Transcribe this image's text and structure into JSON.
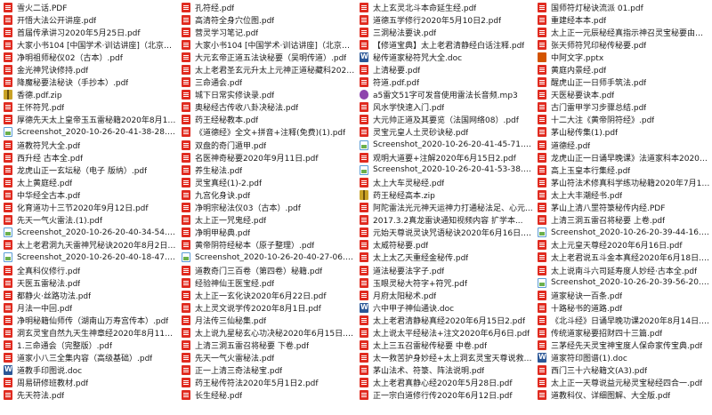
{
  "columns": [
    [
      {
        "name": "雪火二话.PDF",
        "type": "pdf"
      },
      {
        "name": "开悟大法公开讲座.pdf",
        "type": "pdf"
      },
      {
        "name": "首届传承讲习2020年5月25日.pdf",
        "type": "pdf"
      },
      {
        "name": "大家小书104 [中国学术·训诂讲座]（北京出版...",
        "type": "pdf"
      },
      {
        "name": "净明祖师秘仪02（古本）.pdf",
        "type": "pdf"
      },
      {
        "name": "金光神咒诀修持.pdf",
        "type": "pdf"
      },
      {
        "name": "降魔秘要法秘诀（手抄本）.pdf",
        "type": "pdf"
      },
      {
        "name": "香德.pdf.zip",
        "type": "zip"
      },
      {
        "name": "王怀符咒.pdf",
        "type": "pdf"
      },
      {
        "name": "厚德先天太上皇帝玉五雷秘籍2020年8月17日...",
        "type": "pdf"
      },
      {
        "name": "Screenshot_2020-10-26-20-41-38-28.png",
        "type": "png"
      },
      {
        "name": "道教符咒大全.pdf",
        "type": "pdf"
      },
      {
        "name": "西升经 古本全.pdf",
        "type": "pdf"
      },
      {
        "name": "龙虎山正一玄坛秘（电子 版纳）.pdf",
        "type": "pdf"
      },
      {
        "name": "太上黄庭经.pdf",
        "type": "pdf"
      },
      {
        "name": "中华经全古本.pdf",
        "type": "pdf"
      },
      {
        "name": "化育道功十三节2020年9月12日.pdf",
        "type": "pdf"
      },
      {
        "name": "先天一气火雷法.(1).pdf",
        "type": "pdf"
      },
      {
        "name": "Screenshot_2020-10-26-20-40-34-54.png",
        "type": "png"
      },
      {
        "name": "太上老君洞九天雷神咒秘诀2020年8月2日.p...",
        "type": "pdf"
      },
      {
        "name": "Screenshot_2020-10-26-20-40-18-47.png",
        "type": "png"
      },
      {
        "name": "全真科仪修行.pdf",
        "type": "pdf"
      },
      {
        "name": "天医五雷秘法.pdf",
        "type": "pdf"
      },
      {
        "name": "都静火·丝路功法.pdf",
        "type": "pdf"
      },
      {
        "name": "月法一中回.pdf",
        "type": "pdf"
      },
      {
        "name": "净明秘籍仙师传（湖南山万寿宫传本）.pdf",
        "type": "pdf"
      },
      {
        "name": "洞玄灵宝自然九天生神章经2020年8月11日.pdf",
        "type": "pdf"
      },
      {
        "name": "1.三命通会（完整版）.pdf",
        "type": "pdf"
      },
      {
        "name": "道家小八三全集内容（高级基础）.pdf",
        "type": "pdf"
      },
      {
        "name": "道教手印图说.doc",
        "type": "doc"
      },
      {
        "name": "周易研修班教材.pdf",
        "type": "pdf"
      },
      {
        "name": "先天符法.pdf",
        "type": "pdf"
      }
    ],
    [
      {
        "name": "孔符经.pdf",
        "type": "pdf"
      },
      {
        "name": "高清符全身穴位图.pdf",
        "type": "pdf"
      },
      {
        "name": "营灵学习笔记.pdf",
        "type": "pdf"
      },
      {
        "name": "大家小书104 [中国学术·训诂讲座]（北京出版...",
        "type": "pdf"
      },
      {
        "name": "大元玄帝正道五法诀秘要（吴明传道）.pdf",
        "type": "pdf"
      },
      {
        "name": "太上老君圣玄元升太上元神正道秘藏科2020年5...",
        "type": "pdf"
      },
      {
        "name": "三命通会.pdf",
        "type": "pdf"
      },
      {
        "name": "城下日常实修诀录.pdf",
        "type": "pdf"
      },
      {
        "name": "奥秘经古传收八卦决秘法.pdf",
        "type": "pdf"
      },
      {
        "name": "药王经秘教本.pdf",
        "type": "pdf"
      },
      {
        "name": "《道德经》全文+拼音+注释(免费)(1).pdf",
        "type": "pdf"
      },
      {
        "name": "双盘的奇门遁甲.pdf",
        "type": "pdf"
      },
      {
        "name": "名医神奇秘要2020年9月11日.pdf",
        "type": "pdf"
      },
      {
        "name": "养生秘法.pdf",
        "type": "pdf"
      },
      {
        "name": "灵宝真经(1)-2.pdf",
        "type": "pdf"
      },
      {
        "name": "九宫化身诀.pdf",
        "type": "pdf"
      },
      {
        "name": "净明宗秘法仪03（古本）.pdf",
        "type": "pdf"
      },
      {
        "name": "太上正一咒鬼经.pdf",
        "type": "pdf"
      },
      {
        "name": "净明甲秘典.pdf",
        "type": "pdf"
      },
      {
        "name": "黄帝阴符经秘本（原子整理）.pdf",
        "type": "pdf"
      },
      {
        "name": "Screenshot_2020-10-26-20-40-27-06.png",
        "type": "png"
      },
      {
        "name": "道教奇门三百卷（第四卷）秘籍.pdf",
        "type": "pdf"
      },
      {
        "name": "经验神仙王医宝经.pdf",
        "type": "pdf"
      },
      {
        "name": "太上正一玄化诀2020年6月22日.pdf",
        "type": "pdf"
      },
      {
        "name": "太上灵文说学传2020年8月1日.pdf",
        "type": "pdf"
      },
      {
        "name": "月法传三仙秘集.pdf",
        "type": "pdf"
      },
      {
        "name": "太上说九星秘玄心功决秘2020年6月15日.pdf",
        "type": "pdf"
      },
      {
        "name": "上清三洞五雷召将秘要 下卷.pdf",
        "type": "pdf"
      },
      {
        "name": "先天一气火雷秘法.pdf",
        "type": "pdf"
      },
      {
        "name": "正一上清三奇法秘宝.pdf",
        "type": "pdf"
      },
      {
        "name": "药王秘传符法2020年5月1日2.pdf",
        "type": "pdf"
      },
      {
        "name": "长生经秘.pdf",
        "type": "pdf"
      }
    ],
    [
      {
        "name": "太上玄灵北斗本命延生经.pdf",
        "type": "pdf"
      },
      {
        "name": "道德五学修行2020年5月10日2.pdf",
        "type": "pdf"
      },
      {
        "name": "三洞秘法要诀.pdf",
        "type": "pdf"
      },
      {
        "name": "【修道宝典】太上老君清静经白话注释.pdf",
        "type": "pdf"
      },
      {
        "name": "秘传道家秘符咒大全.doc",
        "type": "doc"
      },
      {
        "name": "上清秘要.pdf",
        "type": "pdf"
      },
      {
        "name": "符道.pdf.pdf",
        "type": "pdf"
      },
      {
        "name": "a5雷文51字可发音使用雷法长音频.mp3",
        "type": "mp3"
      },
      {
        "name": "风水学快速入门.pdf",
        "type": "pdf"
      },
      {
        "name": "大元帅正道及其要览（法国网络08）.pdf",
        "type": "pdf"
      },
      {
        "name": "灵宝元皇人土灵砂诀秘.pdf",
        "type": "pdf"
      },
      {
        "name": "Screenshot_2020-10-26-20-41-45-71.png",
        "type": "png"
      },
      {
        "name": "观明大道要+注解2020年6月15日2.pdf",
        "type": "pdf"
      },
      {
        "name": "Screenshot_2020-10-26-20-41-53-38.png",
        "type": "png"
      },
      {
        "name": "太上大车灵秘经.pdf",
        "type": "pdf"
      },
      {
        "name": "药王秘经高本.zip",
        "type": "zip"
      },
      {
        "name": "阿陀雷法光元神天运神力打通秘法足、心元...",
        "type": "pdf"
      },
      {
        "name": "2017.3.2真龙雷诀通知视频内容 扩学本...",
        "type": "pdf"
      },
      {
        "name": "元始天尊说灵诀咒语秘诀2020年6月16日.pdf",
        "type": "pdf"
      },
      {
        "name": "太威符秘要.pdf",
        "type": "pdf"
      },
      {
        "name": "太上太乙天重经金秘传.pdf",
        "type": "pdf"
      },
      {
        "name": "道法秘要法字子.pdf",
        "type": "pdf"
      },
      {
        "name": "玉眼灵秘大符字+符咒.pdf",
        "type": "pdf"
      },
      {
        "name": "月府太阳秘术.pdf",
        "type": "pdf"
      },
      {
        "name": "六中甲子神仙通诀.doc",
        "type": "doc"
      },
      {
        "name": "太上老君清静秘真经2020年6月15日2.pdf",
        "type": "pdf"
      },
      {
        "name": "太上说太平经秘法+注文2020年6月6日.pdf",
        "type": "pdf"
      },
      {
        "name": "太上三五召雷秘传秘要 中卷.pdf",
        "type": "pdf"
      },
      {
        "name": "太一救苦护身妙经+太上洞玄灵宝天尊说救苦...",
        "type": "pdf"
      },
      {
        "name": "茅山法术、符箓、阵法说明.pdf",
        "type": "pdf"
      },
      {
        "name": "太上老君真静心经2020年5月28日.pdf",
        "type": "pdf"
      },
      {
        "name": "正一宗白道修行传2020年6月12日.pdf",
        "type": "pdf"
      }
    ],
    [
      {
        "name": "国师符灯秘诀流派 01.pdf",
        "type": "pdf"
      },
      {
        "name": "重建经本本.pdf",
        "type": "pdf"
      },
      {
        "name": "太上正一元辰秘经真指示神召灵宝秘要由法经...",
        "type": "pdf"
      },
      {
        "name": "张天师符咒印秘传秘要.pdf",
        "type": "pdf"
      },
      {
        "name": "中阿文字.pptx",
        "type": "pptx"
      },
      {
        "name": "黄庭内景经.pdf",
        "type": "pdf"
      },
      {
        "name": "醒虎山正一日师手筑法.pdf",
        "type": "pdf"
      },
      {
        "name": "天医秘要诀本.pdf",
        "type": "pdf"
      },
      {
        "name": "古门雷甲学习步骤总结.pdf",
        "type": "pdf"
      },
      {
        "name": "十二大注《黄帝阴符经》.pdf",
        "type": "pdf"
      },
      {
        "name": "茅山秘传集(1).pdf",
        "type": "pdf"
      },
      {
        "name": "道德经.pdf",
        "type": "pdf"
      },
      {
        "name": "龙虎山正一日诵早晚课》法道家科本2020年7...",
        "type": "pdf"
      },
      {
        "name": "高上玉皇本行集经.pdf",
        "type": "pdf"
      },
      {
        "name": "茅山符法术修真科学练功秘籍2020年7月18日....",
        "type": "pdf"
      },
      {
        "name": "太上大丰潮经书.pdf",
        "type": "pdf"
      },
      {
        "name": "茅山上清八罡符箓秘传内经.PDF",
        "type": "pdf"
      },
      {
        "name": "上清三洞五雷召将秘要 上卷.pdf",
        "type": "pdf"
      },
      {
        "name": "Screenshot_2020-10-26-20-39-44-16.png",
        "type": "png"
      },
      {
        "name": "太上元皇天尊经2020年6月16日.pdf",
        "type": "pdf"
      },
      {
        "name": "太上老君说五斗金本真经2020年6月18日.pdf",
        "type": "pdf"
      },
      {
        "name": "太上说南斗六司延寿度人妙经·古本全.pdf",
        "type": "pdf"
      },
      {
        "name": "Screenshot_2020-10-26-20-39-56-20.png",
        "type": "png"
      },
      {
        "name": "道家秘诀一百条.pdf",
        "type": "pdf"
      },
      {
        "name": "十路秘书的道路.pdf",
        "type": "pdf"
      },
      {
        "name": "《北斗经》日诵早晚功课2020年8月14日.pdf",
        "type": "pdf"
      },
      {
        "name": "传统道家秘要招财四十三篇.pdf",
        "type": "pdf"
      },
      {
        "name": "三茅经先天灵宝神宝度人保命家传宝典.pdf",
        "type": "pdf"
      },
      {
        "name": "道家符印图谱(1).doc",
        "type": "doc"
      },
      {
        "name": "西门三十六秘籍文(A3).pdf",
        "type": "pdf"
      },
      {
        "name": "太上正一天尊说益元秘灵宝秘经四合一.pdf",
        "type": "pdf"
      },
      {
        "name": "道教科仪、详细图解、大全版.pdf",
        "type": "pdf"
      }
    ]
  ]
}
